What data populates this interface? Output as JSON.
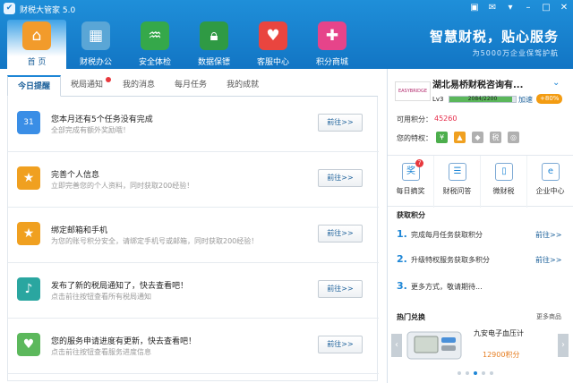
{
  "app": {
    "title": "财税大管家 5.0"
  },
  "nav": [
    {
      "label": "首 页",
      "icon": "home-icon"
    },
    {
      "label": "财税办公",
      "icon": "office-icon"
    },
    {
      "label": "安全体检",
      "icon": "checkup-icon"
    },
    {
      "label": "数据保镖",
      "icon": "lock-icon"
    },
    {
      "label": "客服中心",
      "icon": "heart-calendar-icon"
    },
    {
      "label": "积分商城",
      "icon": "gift-icon"
    }
  ],
  "slogan": {
    "title": "智慧财税，贴心服务",
    "subtitle": "为5000万企业保驾护航"
  },
  "tabs": [
    "今日提醒",
    "税局通知",
    "我的消息",
    "每月任务",
    "我的成就"
  ],
  "tasks": [
    {
      "title": "您本月还有5个任务没有完成",
      "desc": "全部完成有额外奖励哦！",
      "button": "前往>>",
      "icon": "calendar-icon",
      "color": "#3a8ee6",
      "glyph": "31"
    },
    {
      "title": "完善个人信息",
      "desc": "立即完善您的个人资料，同时获取200经验！",
      "button": "前往>>",
      "icon": "star-icon",
      "color": "#f0a020",
      "glyph": "★"
    },
    {
      "title": "绑定邮箱和手机",
      "desc": "为您的账号积分安全，请绑定手机号或邮箱，同时获取200经验！",
      "button": "前往>>",
      "icon": "star-icon",
      "color": "#f0a020",
      "glyph": "★"
    },
    {
      "title": "发布了新的税局通知了，快去查看吧！",
      "desc": "点击前往按钮查看所有税局通知",
      "button": "前往>>",
      "icon": "speaker-icon",
      "color": "#2aa6a0",
      "glyph": "♪"
    },
    {
      "title": "您的服务申请进度有更新，快去查看吧！",
      "desc": "点击前往按钮查看服务进度信息",
      "button": "前往>>",
      "icon": "heart-icon",
      "color": "#5cb85c",
      "glyph": "♥"
    }
  ],
  "user": {
    "company": "湖北易桥财税咨询有...",
    "logo_text": "EASYBRIDGE",
    "level": "Lv3",
    "exp": "2084/2200",
    "exp_fraction": 0.947,
    "speed_label": "加速",
    "speed_value": "+80%",
    "points_label": "可用积分：",
    "points": "45260",
    "privilege_label": "您的特权："
  },
  "quick_links": [
    {
      "label": "每日摘奖",
      "icon": "lottery-icon",
      "badge": "7"
    },
    {
      "label": "财税问答",
      "icon": "qa-icon",
      "badge": ""
    },
    {
      "label": "微财税",
      "icon": "mobile-icon",
      "badge": ""
    },
    {
      "label": "企业中心",
      "icon": "ie-icon",
      "badge": ""
    }
  ],
  "earn": {
    "title": "获取积分",
    "items": [
      {
        "num": "1.",
        "text": "完成每月任务获取积分",
        "go": "前往>>"
      },
      {
        "num": "2.",
        "text": "升级特权服务获取多积分",
        "go": "前往>>"
      },
      {
        "num": "3.",
        "text": "更多方式，敬请期待...",
        "go": ""
      }
    ]
  },
  "hot": {
    "title": "热门兑换",
    "more": "更多商品",
    "product": "九安电子血压计",
    "points": "12900积分"
  }
}
